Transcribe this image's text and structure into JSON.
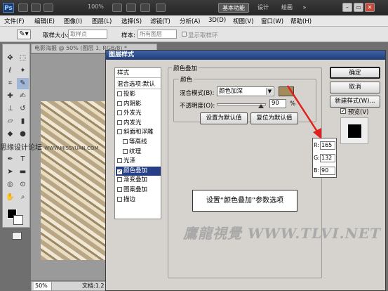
{
  "titlebar": {
    "logo": "Ps",
    "zoom": "100%",
    "workspaces": [
      "基本功能",
      "设计",
      "绘画"
    ],
    "window_controls": [
      "minimize-icon",
      "restore-icon",
      "close-icon"
    ]
  },
  "menu": [
    "文件(F)",
    "编辑(E)",
    "图像(I)",
    "图层(L)",
    "选择(S)",
    "滤镜(T)",
    "分析(A)",
    "3D(D)",
    "视图(V)",
    "窗口(W)",
    "帮助(H)"
  ],
  "options": {
    "sample_size_label": "取样大小:",
    "sample_size_value": "取样点",
    "sample_label": "样本:",
    "sample_value": "所有图层",
    "show_ring_label": "显示取样环"
  },
  "document": {
    "tab_title": "电影海报 @ 50% (图层 1, RGB/8) *",
    "zoom": "50%",
    "doc_info": "文档:1.2"
  },
  "dialog": {
    "title": "图层样式",
    "styles_header": "样式",
    "blend_options": "混合选项:默认",
    "effects": [
      {
        "label": "投影",
        "checked": false,
        "selected": false,
        "indent": false
      },
      {
        "label": "内阴影",
        "checked": false,
        "selected": false,
        "indent": false
      },
      {
        "label": "外发光",
        "checked": false,
        "selected": false,
        "indent": false
      },
      {
        "label": "内发光",
        "checked": false,
        "selected": false,
        "indent": false
      },
      {
        "label": "斜面和浮雕",
        "checked": false,
        "selected": false,
        "indent": false
      },
      {
        "label": "等高线",
        "checked": false,
        "selected": false,
        "indent": true
      },
      {
        "label": "纹理",
        "checked": false,
        "selected": false,
        "indent": true
      },
      {
        "label": "光泽",
        "checked": false,
        "selected": false,
        "indent": false
      },
      {
        "label": "颜色叠加",
        "checked": true,
        "selected": true,
        "indent": false
      },
      {
        "label": "渐变叠加",
        "checked": false,
        "selected": false,
        "indent": false
      },
      {
        "label": "图案叠加",
        "checked": false,
        "selected": false,
        "indent": false
      },
      {
        "label": "描边",
        "checked": false,
        "selected": false,
        "indent": false
      }
    ],
    "overlay_group": "颜色叠加",
    "color_group": "颜色",
    "blend_mode_label": "混合模式(B):",
    "blend_mode_value": "颜色加深",
    "swatch_color": "#a58a5a",
    "opacity_label": "不透明度(O):",
    "opacity_value": "90",
    "opacity_unit": "%",
    "opacity_fraction": 0.9,
    "set_default": "设置为默认值",
    "reset_default": "复位为默认值",
    "ok": "确定",
    "cancel": "取消",
    "new_style": "新建样式(W)...",
    "preview_label": "预览(V)",
    "preview_checked": true
  },
  "callout": "设置“颜色叠加”参数选项",
  "rgb": {
    "r_label": "R:",
    "r": "165",
    "g_label": "G:",
    "g": "132",
    "b_label": "B:",
    "b": "90"
  },
  "watermark": "鷹龍視覺 WWW.TLVI.NET",
  "watermark_left": "思缘设计论坛",
  "watermark_left_small": "WWW.MISSYUAN.COM",
  "colors": {
    "accent_arrow": "#e0201c",
    "selection": "#263f86",
    "title_bar": "#203c78"
  }
}
